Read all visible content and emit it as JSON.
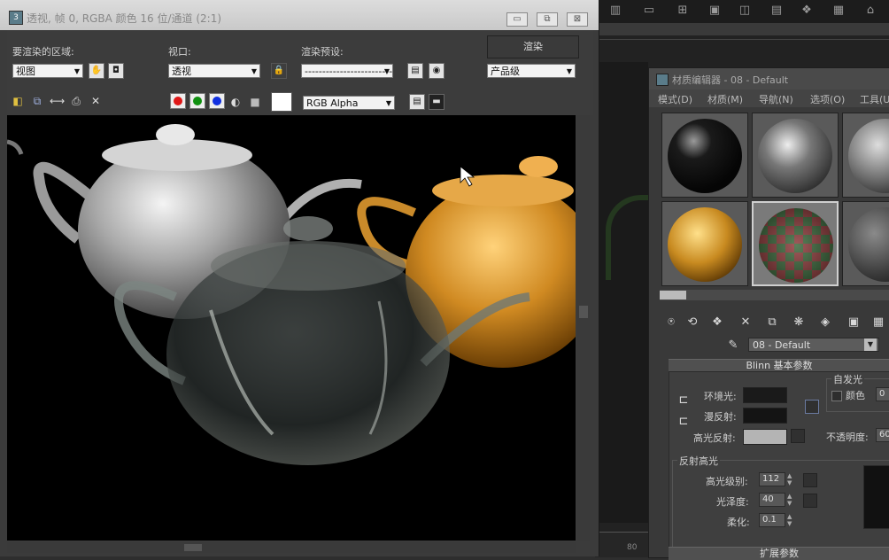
{
  "render_window": {
    "title": "透视, 帧 0, RGBA 颜色 16 位/通道 (2:1)",
    "title_buttons": {
      "minimize": "▭",
      "restore": "⧉",
      "close": "⊠"
    },
    "area_label": "要渲染的区域:",
    "area_value": "视图",
    "viewport_label": "视口:",
    "viewport_value": "透视",
    "preset_label": "渲染预设:",
    "preset_value": "-------------------------",
    "render_button": "渲染",
    "product_value": "产品级",
    "channel_value": "RGB Alpha"
  },
  "material_editor": {
    "title": "材质编辑器 - 08 - Default",
    "menus": [
      "模式(D)",
      "材质(M)",
      "导航(N)",
      "选项(O)",
      "工具(U)"
    ],
    "material_name": "08 - Default",
    "blinn_rollout": "Blinn 基本参数",
    "self_illum_label": "自发光",
    "color_label": "颜色",
    "color_value": "0",
    "ambient_label": "环境光:",
    "diffuse_label": "漫反射:",
    "specular_label": "高光反射:",
    "opacity_label": "不透明度:",
    "opacity_value": "60",
    "spec_group": "反射高光",
    "spec_level_label": "高光级别:",
    "spec_level_value": "112",
    "gloss_label": "光泽度:",
    "gloss_value": "40",
    "soften_label": "柔化:",
    "soften_value": "0.1",
    "ext_rollout": "扩展参数"
  },
  "background": {
    "ruler_value": "80"
  },
  "colors": {
    "ambient": "#1a1a1a",
    "diffuse": "#141414",
    "specular": "#b4b4b4",
    "gold": "#d89a2e"
  }
}
